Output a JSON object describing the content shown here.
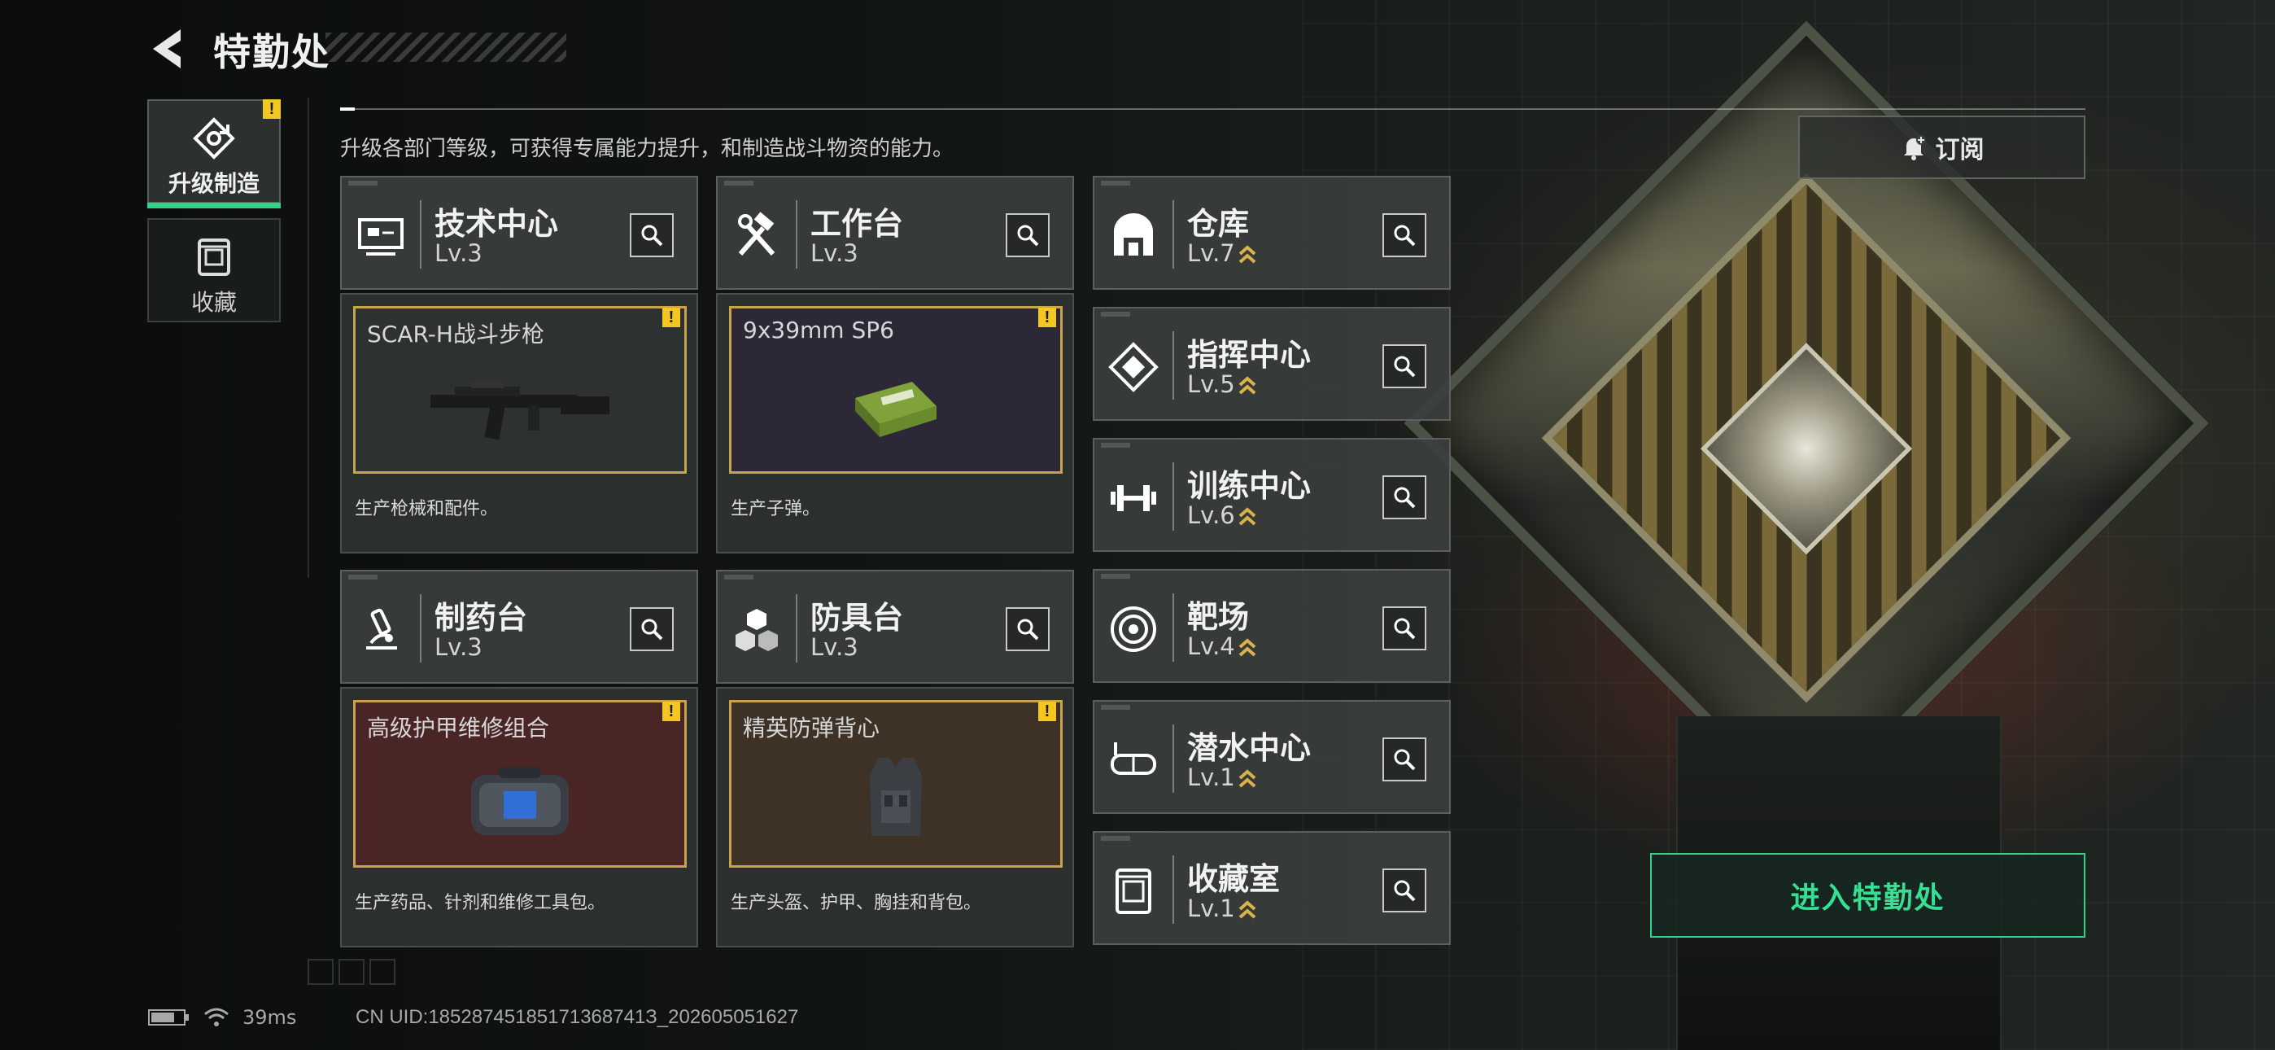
{
  "header": {
    "title": "特勤处",
    "subtitle": "升级各部门等级，可获得专属能力提升，和制造战斗物资的能力。"
  },
  "sidebar": {
    "tabs": [
      {
        "label": "升级制造",
        "active": true,
        "alert": "!"
      },
      {
        "label": "收藏",
        "active": false
      }
    ]
  },
  "departments": {
    "tech": {
      "name": "技术中心",
      "level": "Lv.3",
      "icon": "monitor-icon"
    },
    "workbench": {
      "name": "工作台",
      "level": "Lv.3",
      "icon": "hammer-wrench-icon"
    },
    "pharmacy": {
      "name": "制药台",
      "level": "Lv.3",
      "icon": "microscope-icon"
    },
    "armor": {
      "name": "防具台",
      "level": "Lv.3",
      "icon": "cubes-icon"
    },
    "warehouse": {
      "name": "仓库",
      "level": "Lv.7",
      "icon": "warehouse-icon"
    },
    "command": {
      "name": "指挥中心",
      "level": "Lv.5",
      "icon": "command-icon"
    },
    "training": {
      "name": "训练中心",
      "level": "Lv.6",
      "icon": "dumbbell-icon"
    },
    "range": {
      "name": "靶场",
      "level": "Lv.4",
      "icon": "target-icon"
    },
    "diving": {
      "name": "潜水中心",
      "level": "Lv.1",
      "icon": "goggles-icon"
    },
    "collection": {
      "name": "收藏室",
      "level": "Lv.1",
      "icon": "collection-icon"
    }
  },
  "items": {
    "tech": {
      "name": "SCAR-H战斗步枪",
      "desc": "生产枪械和配件。",
      "alert": "!",
      "bg": "#2e3132"
    },
    "workbench": {
      "name": "9x39mm SP6",
      "desc": "生产子弹。",
      "alert": "!",
      "bg": "#2d2838"
    },
    "pharmacy": {
      "name": "高级护甲维修组合",
      "desc": "生产药品、针剂和维修工具包。",
      "alert": "!",
      "bg": "#4a2526"
    },
    "armor": {
      "name": "精英防弹背心",
      "desc": "生产头盔、护甲、胸挂和背包。",
      "alert": "!",
      "bg": "#3e3126"
    }
  },
  "right": {
    "subscribe_label": "订阅",
    "enter_label": "进入特勤处"
  },
  "status": {
    "ping": "39ms",
    "uid": "CN UID:18528745185171368741З_202605051627"
  },
  "colors": {
    "accent": "#2fd38a",
    "alert": "#f3c623",
    "frame": "#c9a34a"
  }
}
